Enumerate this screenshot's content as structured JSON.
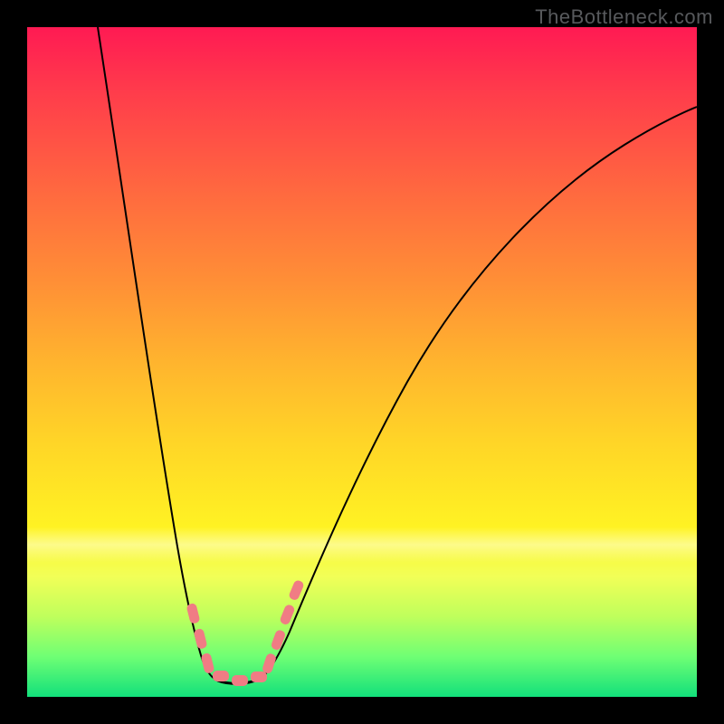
{
  "watermark": "TheBottleneck.com",
  "chart_data": {
    "type": "line",
    "title": "",
    "xlabel": "",
    "ylabel": "",
    "xlim": [
      0,
      100
    ],
    "ylim": [
      0,
      100
    ],
    "series": [
      {
        "name": "bottleneck-curve",
        "x": [
          10,
          14,
          18,
          22,
          24,
          26,
          28,
          30,
          32,
          34,
          36,
          40,
          46,
          54,
          64,
          76,
          88,
          100
        ],
        "y": [
          100,
          72,
          46,
          24,
          13,
          6,
          2,
          1,
          2,
          4,
          8,
          18,
          33,
          49,
          63,
          76,
          85,
          89
        ]
      }
    ],
    "markers": {
      "name": "sweet-spot-beads",
      "color": "#f07c84",
      "x": [
        24.5,
        25.6,
        26.7,
        28.2,
        30.8,
        33.4,
        35.7,
        37.0,
        38.3,
        39.6
      ],
      "y": [
        13.9,
        10.1,
        6.5,
        3.9,
        2.3,
        3.8,
        6.5,
        10.0,
        13.8,
        17.4
      ]
    },
    "background_gradient": {
      "direction": "top-to-bottom",
      "stops": [
        {
          "pos": 0.0,
          "color": "#ff1a53"
        },
        {
          "pos": 0.25,
          "color": "#ff6a3f"
        },
        {
          "pos": 0.5,
          "color": "#ffb42e"
        },
        {
          "pos": 0.75,
          "color": "#fff323"
        },
        {
          "pos": 0.92,
          "color": "#8fff68"
        },
        {
          "pos": 1.0,
          "color": "#12e07b"
        }
      ]
    }
  }
}
